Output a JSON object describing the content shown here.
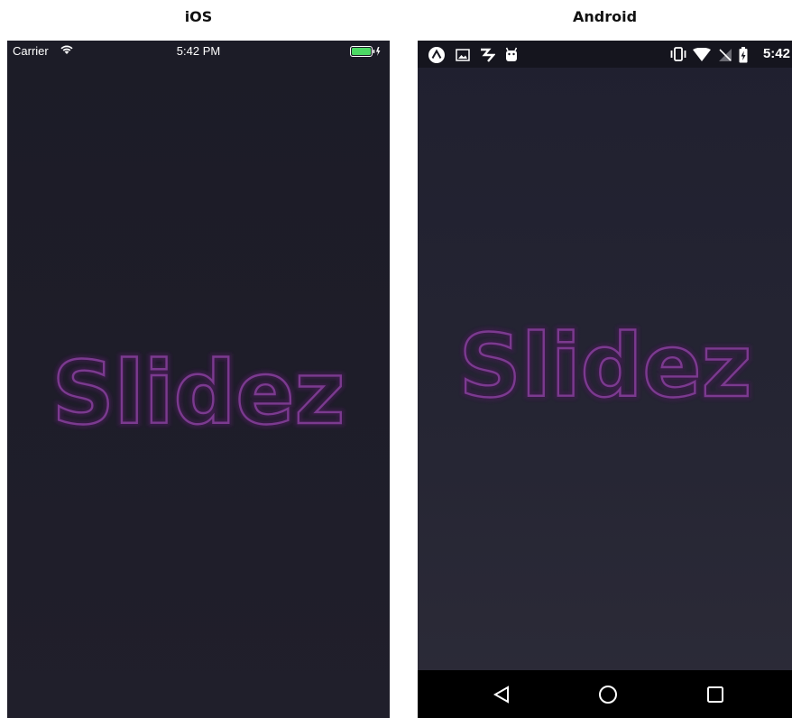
{
  "labels": {
    "ios": "iOS",
    "android": "Android"
  },
  "ios": {
    "status_bar": {
      "carrier": "Carrier",
      "time": "5:42 PM"
    },
    "logo": "Slidez"
  },
  "android": {
    "status_bar": {
      "time": "5:42"
    },
    "logo": "Slidez",
    "nav": {
      "back": "back-icon",
      "home": "home-icon",
      "recents": "recents-icon"
    }
  },
  "colors": {
    "logo_stroke": "#7b3a8f",
    "battery": "#4cd964",
    "screen_bg": "#1e1d29"
  }
}
